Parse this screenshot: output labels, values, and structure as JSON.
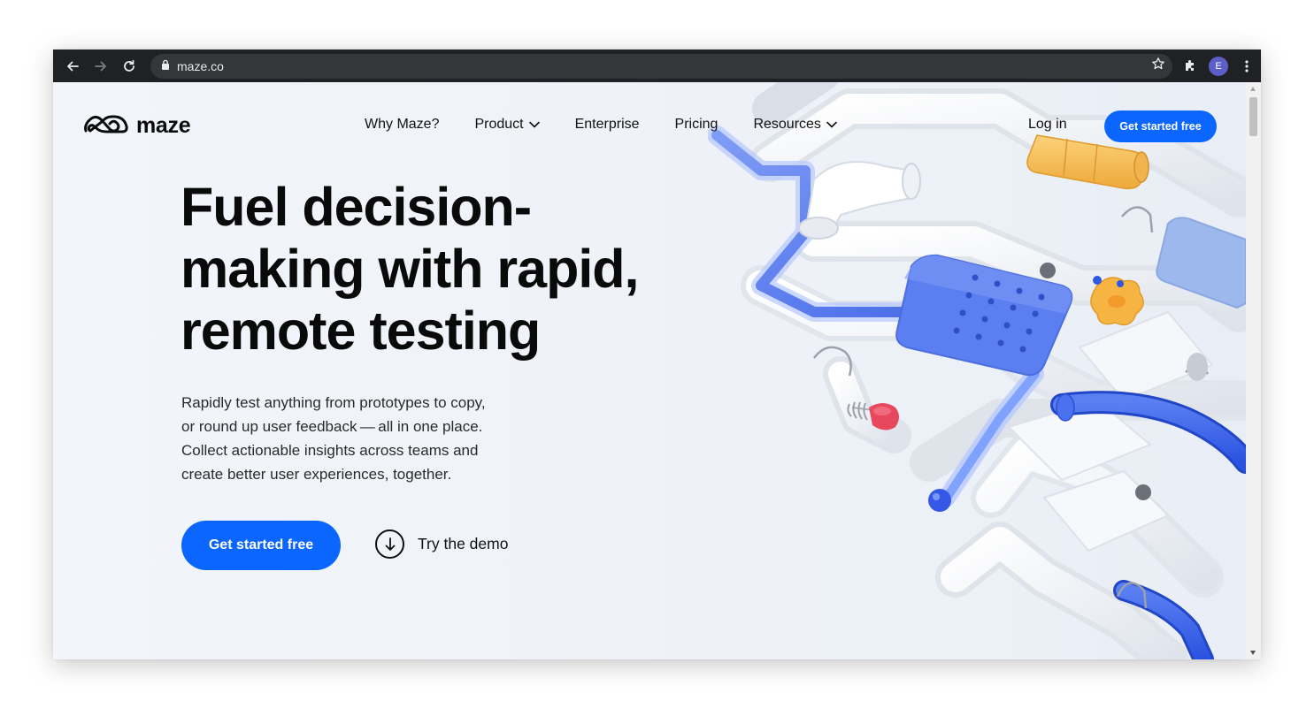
{
  "browser": {
    "url": "maze.co",
    "profile_initial": "E",
    "icons": [
      "back-icon",
      "forward-icon",
      "reload-icon",
      "lock-icon",
      "star-icon",
      "extensions-icon",
      "menu-icon"
    ]
  },
  "site": {
    "logo_text": "maze",
    "nav": [
      {
        "label": "Why Maze?"
      },
      {
        "label": "Product"
      },
      {
        "label": "Enterprise"
      },
      {
        "label": "Pricing"
      },
      {
        "label": "Resources"
      }
    ],
    "login_label": "Log in",
    "header_cta": "Get started free"
  },
  "hero": {
    "headline_lines": [
      "Fuel decision-",
      "making with rapid,",
      "remote testing"
    ],
    "subtext_lines": [
      "Rapidly test anything from prototypes to copy,",
      "or round up user feedback — all in one place.",
      "Collect actionable insights across teams and",
      "create better user experiences, together."
    ],
    "primary_cta": "Get started free",
    "demo_label": "Try the demo"
  },
  "colors": {
    "accent": "#0a66ff",
    "chrome": "#202124",
    "page_background": "#eef2f8"
  }
}
